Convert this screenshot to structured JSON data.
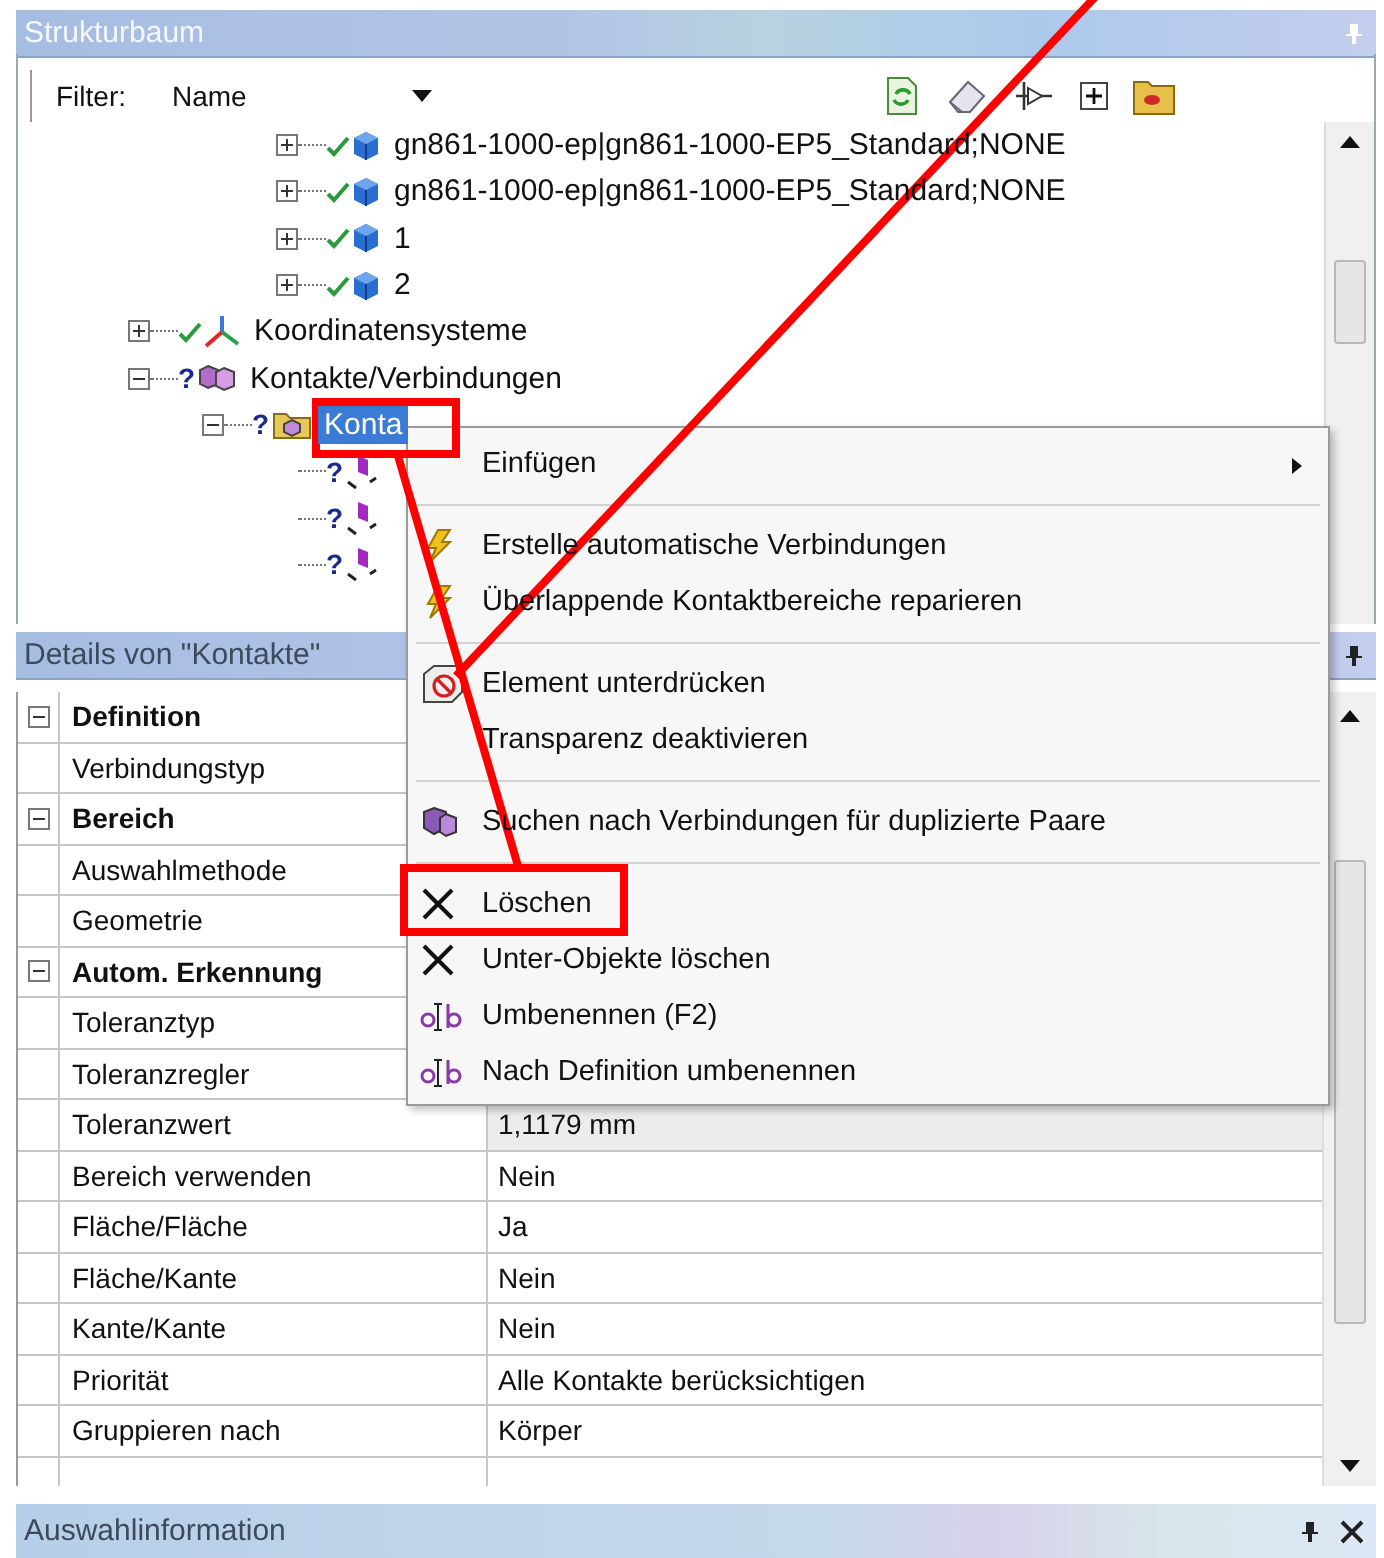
{
  "structure_panel": {
    "title": "Strukturbaum",
    "filter": {
      "label": "Filter:",
      "value": "Name"
    },
    "tree": [
      {
        "children": [
          {
            "children": [
              {
                "label": "gn861-1000-ep|gn861-1000-EP5_Standard;NONE",
                "kind": "part",
                "checked": true,
                "expanded": false,
                "selected": false
              },
              {
                "label": "gn861-1000-ep|gn861-1000-EP5_Standard;NONE",
                "kind": "part",
                "checked": true,
                "expanded": false,
                "selected": false
              },
              {
                "label": "1",
                "kind": "part",
                "checked": true,
                "expanded": false,
                "selected": false
              },
              {
                "label": "2",
                "kind": "part",
                "checked": true,
                "expanded": false,
                "selected": false
              }
            ]
          }
        ]
      },
      {
        "label": "Koordinatensysteme",
        "kind": "coordinates",
        "checked": true,
        "expanded": false,
        "selected": false
      },
      {
        "label": "Kontakte/Verbindungen",
        "kind": "connections",
        "checked": false,
        "mark": "?",
        "expanded": true,
        "selected": false,
        "children": [
          {
            "label": "Konta",
            "kind": "folder",
            "checked": false,
            "mark": "?",
            "expanded": true,
            "selected": true,
            "children": [
              {
                "kind": "contact",
                "mark": "?",
                "checked": false
              },
              {
                "kind": "contact",
                "mark": "?",
                "checked": false
              },
              {
                "kind": "contact",
                "mark": "?",
                "checked": false
              }
            ]
          }
        ]
      }
    ]
  },
  "details_panel": {
    "title": "Details von \"Kontakte\"",
    "rows": [
      {
        "kind": "category",
        "label": "Definition",
        "expanded": true
      },
      {
        "kind": "property",
        "label": "Verbindungstyp"
      },
      {
        "kind": "category",
        "label": "Bereich",
        "expanded": true
      },
      {
        "kind": "property",
        "label": "Auswahlmethode"
      },
      {
        "kind": "property",
        "label": "Geometrie"
      },
      {
        "kind": "category",
        "label": "Autom. Erkennung",
        "expanded": true
      },
      {
        "kind": "property",
        "label": "Toleranztyp"
      },
      {
        "kind": "property",
        "label": "Toleranzregler"
      },
      {
        "kind": "property",
        "label": "Toleranzwert",
        "value": "1,1179 mm",
        "selected": true
      },
      {
        "kind": "property",
        "label": "Bereich verwenden",
        "value": "Nein",
        "selected": false
      },
      {
        "kind": "property",
        "label": "Fläche/Fläche",
        "value": "Ja",
        "selected": false
      },
      {
        "kind": "property",
        "label": "Fläche/Kante",
        "value": "Nein",
        "selected": false
      },
      {
        "kind": "property",
        "label": "Kante/Kante",
        "value": "Nein",
        "selected": false
      },
      {
        "kind": "property",
        "label": "Priorität",
        "value": "Alle Kontakte berücksichtigen",
        "selected": false
      },
      {
        "kind": "property",
        "label": "Gruppieren nach",
        "value": "Körper",
        "selected": false
      }
    ]
  },
  "context_menu": {
    "items": [
      {
        "kind": "item",
        "label": "Einfügen",
        "submenu": true
      },
      {
        "kind": "separator"
      },
      {
        "kind": "item",
        "label": "Erstelle automatische Verbindungen",
        "submenu": false
      },
      {
        "kind": "item",
        "label": "Überlappende Kontaktbereiche reparieren",
        "submenu": false
      },
      {
        "kind": "separator"
      },
      {
        "kind": "item",
        "label": "Element unterdrücken",
        "submenu": false
      },
      {
        "kind": "item",
        "label": "Transparenz deaktivieren",
        "submenu": false
      },
      {
        "kind": "separator"
      },
      {
        "kind": "item",
        "label": "Suchen nach Verbindungen für duplizierte Paare",
        "submenu": false
      },
      {
        "kind": "separator"
      },
      {
        "kind": "item",
        "label": "Löschen",
        "submenu": false
      },
      {
        "kind": "item",
        "label": "Unter-Objekte löschen",
        "submenu": false
      },
      {
        "kind": "item",
        "label": "Umbenennen (F2)",
        "submenu": false
      },
      {
        "kind": "item",
        "label": "Nach Definition umbenennen",
        "submenu": false
      }
    ]
  },
  "info_panel": {
    "title": "Auswahlinformation"
  }
}
